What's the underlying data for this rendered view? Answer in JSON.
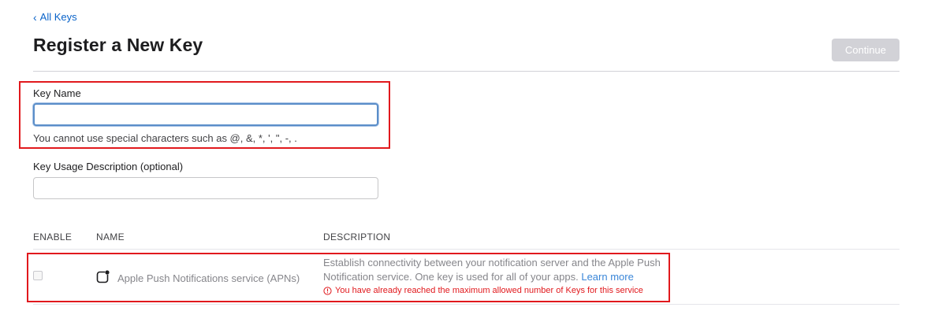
{
  "nav": {
    "back_label": "All Keys"
  },
  "header": {
    "title": "Register a New Key",
    "continue_label": "Continue"
  },
  "form": {
    "key_name": {
      "label": "Key Name",
      "value": "",
      "hint": "You cannot use special characters such as @, &, *, ', \", -, ."
    },
    "key_desc": {
      "label": "Key Usage Description (optional)",
      "value": ""
    }
  },
  "services_table": {
    "columns": [
      "ENABLE",
      "NAME",
      "DESCRIPTION"
    ],
    "rows": [
      {
        "enabled": false,
        "icon": "notification-badge-icon",
        "name": "Apple Push Notifications service (APNs)",
        "description_line1": "Establish connectivity between your notification server and the Apple Push",
        "description_line2": "Notification service. One key is used for all of your apps.",
        "learn_more": "Learn more",
        "warning": "You have already reached the maximum allowed number of Keys for this service"
      }
    ]
  },
  "colors": {
    "accent": "#0a63c9",
    "highlight_box": "#e1191d",
    "disabled_button": "#d2d2d7"
  }
}
